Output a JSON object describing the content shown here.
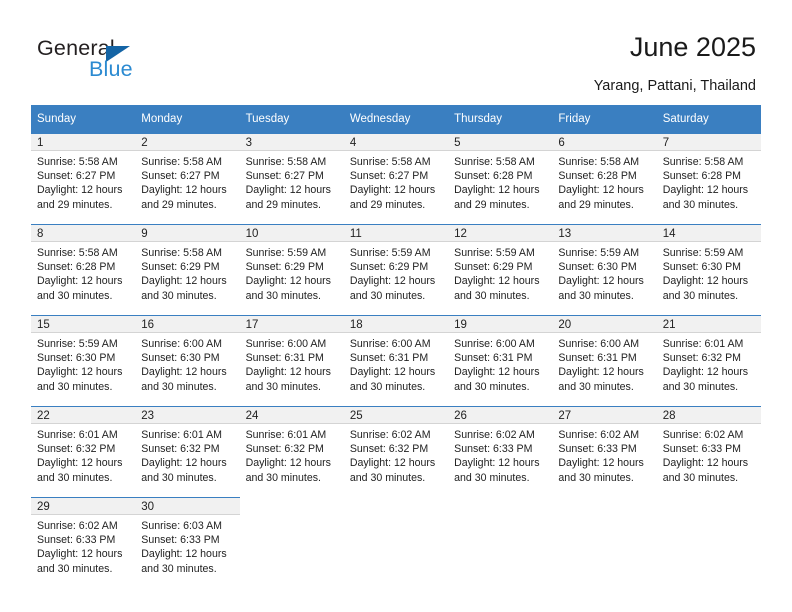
{
  "brand": {
    "name_part1": "General",
    "name_part2": "Blue"
  },
  "header": {
    "title": "June 2025",
    "subtitle": "Yarang, Pattani, Thailand"
  },
  "colors": {
    "header_blue": "#3a7fc1",
    "logo_blue": "#2b8ad1",
    "logo_triangle": "#1464a5",
    "daynum_band": "#f1f1f1"
  },
  "weekday_headers": [
    "Sunday",
    "Monday",
    "Tuesday",
    "Wednesday",
    "Thursday",
    "Friday",
    "Saturday"
  ],
  "labels": {
    "sunrise_prefix": "Sunrise:",
    "sunset_prefix": "Sunset:",
    "daylight_prefix": "Daylight:"
  },
  "weeks": [
    [
      {
        "day": "1",
        "sunrise": "Sunrise: 5:58 AM",
        "sunset": "Sunset: 6:27 PM",
        "daylight": "Daylight: 12 hours and 29 minutes."
      },
      {
        "day": "2",
        "sunrise": "Sunrise: 5:58 AM",
        "sunset": "Sunset: 6:27 PM",
        "daylight": "Daylight: 12 hours and 29 minutes."
      },
      {
        "day": "3",
        "sunrise": "Sunrise: 5:58 AM",
        "sunset": "Sunset: 6:27 PM",
        "daylight": "Daylight: 12 hours and 29 minutes."
      },
      {
        "day": "4",
        "sunrise": "Sunrise: 5:58 AM",
        "sunset": "Sunset: 6:27 PM",
        "daylight": "Daylight: 12 hours and 29 minutes."
      },
      {
        "day": "5",
        "sunrise": "Sunrise: 5:58 AM",
        "sunset": "Sunset: 6:28 PM",
        "daylight": "Daylight: 12 hours and 29 minutes."
      },
      {
        "day": "6",
        "sunrise": "Sunrise: 5:58 AM",
        "sunset": "Sunset: 6:28 PM",
        "daylight": "Daylight: 12 hours and 29 minutes."
      },
      {
        "day": "7",
        "sunrise": "Sunrise: 5:58 AM",
        "sunset": "Sunset: 6:28 PM",
        "daylight": "Daylight: 12 hours and 30 minutes."
      }
    ],
    [
      {
        "day": "8",
        "sunrise": "Sunrise: 5:58 AM",
        "sunset": "Sunset: 6:28 PM",
        "daylight": "Daylight: 12 hours and 30 minutes."
      },
      {
        "day": "9",
        "sunrise": "Sunrise: 5:58 AM",
        "sunset": "Sunset: 6:29 PM",
        "daylight": "Daylight: 12 hours and 30 minutes."
      },
      {
        "day": "10",
        "sunrise": "Sunrise: 5:59 AM",
        "sunset": "Sunset: 6:29 PM",
        "daylight": "Daylight: 12 hours and 30 minutes."
      },
      {
        "day": "11",
        "sunrise": "Sunrise: 5:59 AM",
        "sunset": "Sunset: 6:29 PM",
        "daylight": "Daylight: 12 hours and 30 minutes."
      },
      {
        "day": "12",
        "sunrise": "Sunrise: 5:59 AM",
        "sunset": "Sunset: 6:29 PM",
        "daylight": "Daylight: 12 hours and 30 minutes."
      },
      {
        "day": "13",
        "sunrise": "Sunrise: 5:59 AM",
        "sunset": "Sunset: 6:30 PM",
        "daylight": "Daylight: 12 hours and 30 minutes."
      },
      {
        "day": "14",
        "sunrise": "Sunrise: 5:59 AM",
        "sunset": "Sunset: 6:30 PM",
        "daylight": "Daylight: 12 hours and 30 minutes."
      }
    ],
    [
      {
        "day": "15",
        "sunrise": "Sunrise: 5:59 AM",
        "sunset": "Sunset: 6:30 PM",
        "daylight": "Daylight: 12 hours and 30 minutes."
      },
      {
        "day": "16",
        "sunrise": "Sunrise: 6:00 AM",
        "sunset": "Sunset: 6:30 PM",
        "daylight": "Daylight: 12 hours and 30 minutes."
      },
      {
        "day": "17",
        "sunrise": "Sunrise: 6:00 AM",
        "sunset": "Sunset: 6:31 PM",
        "daylight": "Daylight: 12 hours and 30 minutes."
      },
      {
        "day": "18",
        "sunrise": "Sunrise: 6:00 AM",
        "sunset": "Sunset: 6:31 PM",
        "daylight": "Daylight: 12 hours and 30 minutes."
      },
      {
        "day": "19",
        "sunrise": "Sunrise: 6:00 AM",
        "sunset": "Sunset: 6:31 PM",
        "daylight": "Daylight: 12 hours and 30 minutes."
      },
      {
        "day": "20",
        "sunrise": "Sunrise: 6:00 AM",
        "sunset": "Sunset: 6:31 PM",
        "daylight": "Daylight: 12 hours and 30 minutes."
      },
      {
        "day": "21",
        "sunrise": "Sunrise: 6:01 AM",
        "sunset": "Sunset: 6:32 PM",
        "daylight": "Daylight: 12 hours and 30 minutes."
      }
    ],
    [
      {
        "day": "22",
        "sunrise": "Sunrise: 6:01 AM",
        "sunset": "Sunset: 6:32 PM",
        "daylight": "Daylight: 12 hours and 30 minutes."
      },
      {
        "day": "23",
        "sunrise": "Sunrise: 6:01 AM",
        "sunset": "Sunset: 6:32 PM",
        "daylight": "Daylight: 12 hours and 30 minutes."
      },
      {
        "day": "24",
        "sunrise": "Sunrise: 6:01 AM",
        "sunset": "Sunset: 6:32 PM",
        "daylight": "Daylight: 12 hours and 30 minutes."
      },
      {
        "day": "25",
        "sunrise": "Sunrise: 6:02 AM",
        "sunset": "Sunset: 6:32 PM",
        "daylight": "Daylight: 12 hours and 30 minutes."
      },
      {
        "day": "26",
        "sunrise": "Sunrise: 6:02 AM",
        "sunset": "Sunset: 6:33 PM",
        "daylight": "Daylight: 12 hours and 30 minutes."
      },
      {
        "day": "27",
        "sunrise": "Sunrise: 6:02 AM",
        "sunset": "Sunset: 6:33 PM",
        "daylight": "Daylight: 12 hours and 30 minutes."
      },
      {
        "day": "28",
        "sunrise": "Sunrise: 6:02 AM",
        "sunset": "Sunset: 6:33 PM",
        "daylight": "Daylight: 12 hours and 30 minutes."
      }
    ],
    [
      {
        "day": "29",
        "sunrise": "Sunrise: 6:02 AM",
        "sunset": "Sunset: 6:33 PM",
        "daylight": "Daylight: 12 hours and 30 minutes."
      },
      {
        "day": "30",
        "sunrise": "Sunrise: 6:03 AM",
        "sunset": "Sunset: 6:33 PM",
        "daylight": "Daylight: 12 hours and 30 minutes."
      },
      {
        "day": "",
        "sunrise": "",
        "sunset": "",
        "daylight": ""
      },
      {
        "day": "",
        "sunrise": "",
        "sunset": "",
        "daylight": ""
      },
      {
        "day": "",
        "sunrise": "",
        "sunset": "",
        "daylight": ""
      },
      {
        "day": "",
        "sunrise": "",
        "sunset": "",
        "daylight": ""
      },
      {
        "day": "",
        "sunrise": "",
        "sunset": "",
        "daylight": ""
      }
    ]
  ]
}
